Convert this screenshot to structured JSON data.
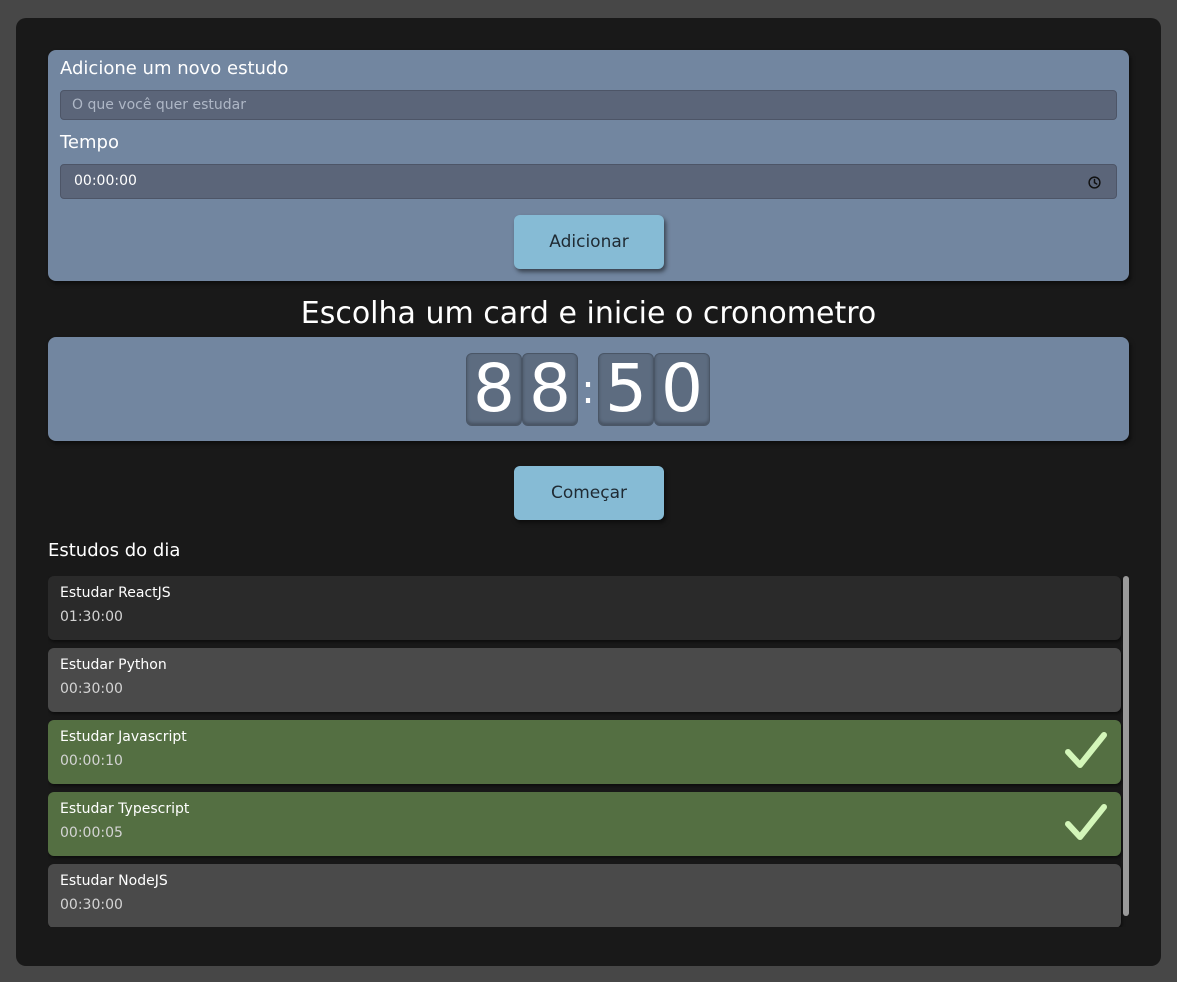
{
  "form": {
    "study_label": "Adicione um novo estudo",
    "study_placeholder": "O que você quer estudar",
    "time_label": "Tempo",
    "time_value": "00:00:00",
    "time_icon": "clock-icon",
    "add_label": "Adicionar"
  },
  "timer": {
    "heading": "Escolha um card e inicie o cronometro",
    "digits": [
      "8",
      "8",
      "5",
      "0"
    ],
    "separator": ":",
    "start_label": "Começar"
  },
  "list": {
    "title": "Estudos do dia",
    "items": [
      {
        "title": "Estudar ReactJS",
        "time": "01:30:00",
        "completed": false,
        "selected": true
      },
      {
        "title": "Estudar Python",
        "time": "00:30:00",
        "completed": false,
        "selected": false
      },
      {
        "title": "Estudar Javascript",
        "time": "00:00:10",
        "completed": true,
        "selected": false
      },
      {
        "title": "Estudar Typescript",
        "time": "00:00:05",
        "completed": true,
        "selected": false
      },
      {
        "title": "Estudar NodeJS",
        "time": "00:30:00",
        "completed": false,
        "selected": false
      }
    ]
  },
  "colors": {
    "page_bg": "#474747",
    "app_bg": "#191919",
    "panel_bg": "#7286a0",
    "button_bg": "#86bbd5",
    "completed_bg": "#546f42",
    "check_color": "#d3f6b9"
  }
}
